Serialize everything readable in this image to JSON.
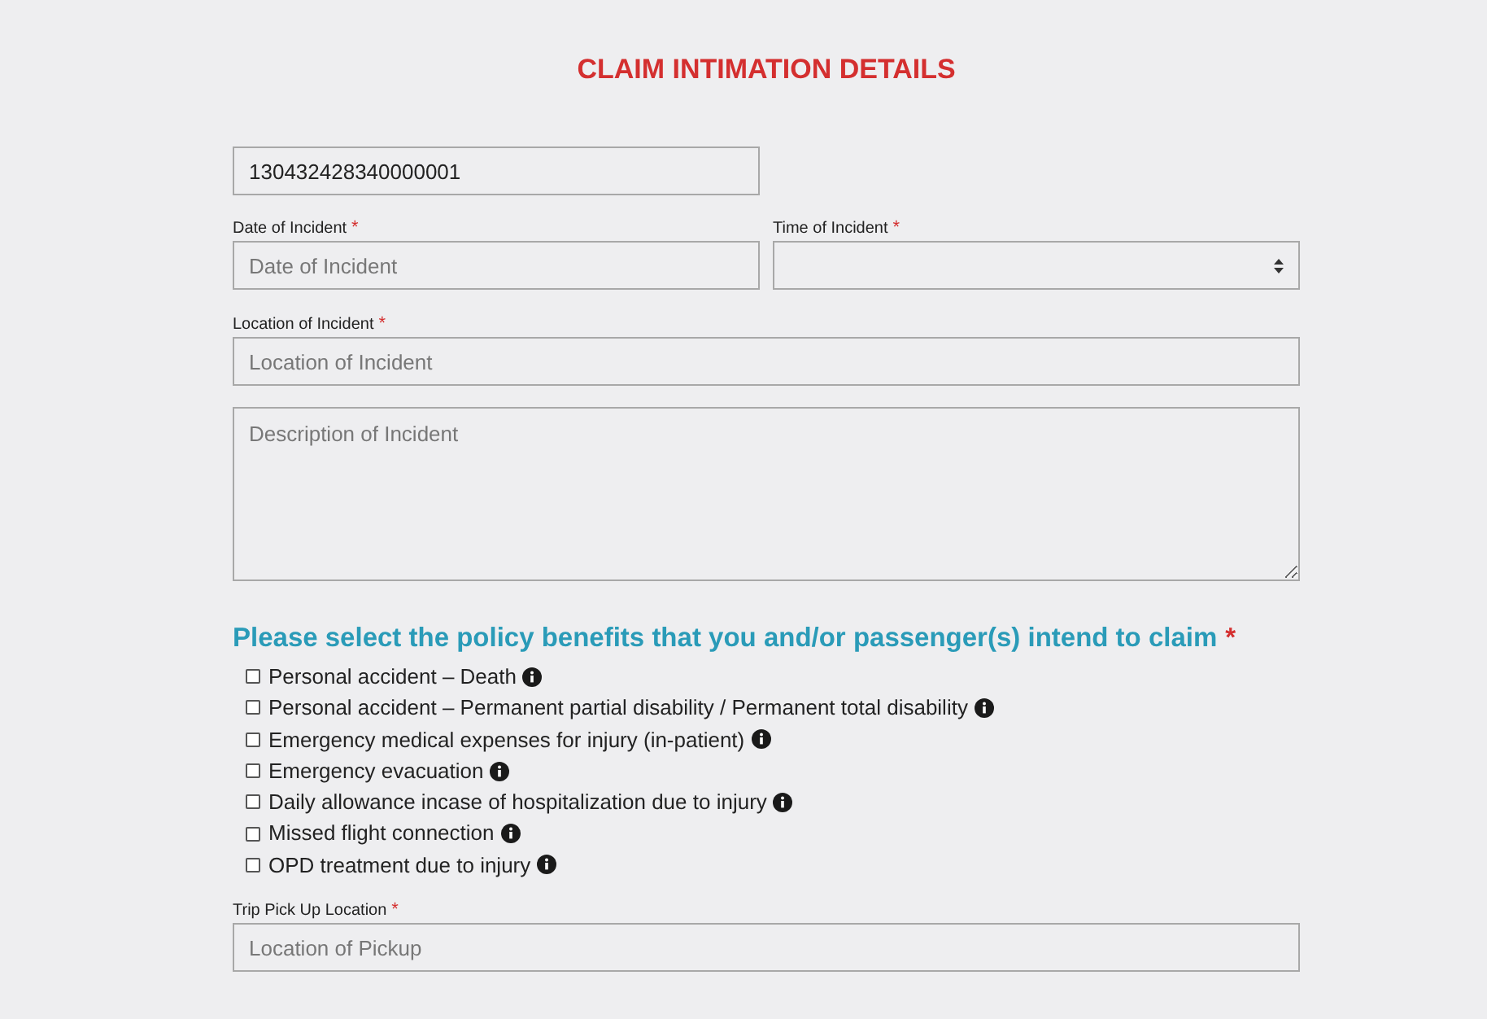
{
  "title": "CLAIM INTIMATION DETAILS",
  "policy_number": {
    "value": "130432428340000001"
  },
  "date_of_incident": {
    "label": "Date of Incident",
    "required_mark": "*",
    "placeholder": "Date of Incident"
  },
  "time_of_incident": {
    "label": "Time of Incident",
    "required_mark": "*"
  },
  "location_of_incident": {
    "label": "Location of Incident",
    "required_mark": "*",
    "placeholder": "Location of Incident"
  },
  "description": {
    "placeholder": "Description of Incident"
  },
  "benefits": {
    "heading": "Please select the policy benefits that you and/or passenger(s) intend to claim",
    "required_mark": "*",
    "options": [
      {
        "label": "Personal accident – Death",
        "checked": false
      },
      {
        "label": "Personal accident – Permanent partial disability / Permanent total disability",
        "checked": false
      },
      {
        "label": "Emergency medical expenses for injury (in-patient)",
        "checked": false
      },
      {
        "label": "Emergency evacuation",
        "checked": false
      },
      {
        "label": "Daily allowance incase of hospitalization due to injury",
        "checked": false
      },
      {
        "label": "Missed flight connection",
        "checked": false
      },
      {
        "label": "OPD treatment due to injury",
        "checked": false
      }
    ]
  },
  "trip_pickup_location": {
    "label": "Trip Pick Up Location",
    "required_mark": "*",
    "placeholder": "Location of Pickup"
  }
}
